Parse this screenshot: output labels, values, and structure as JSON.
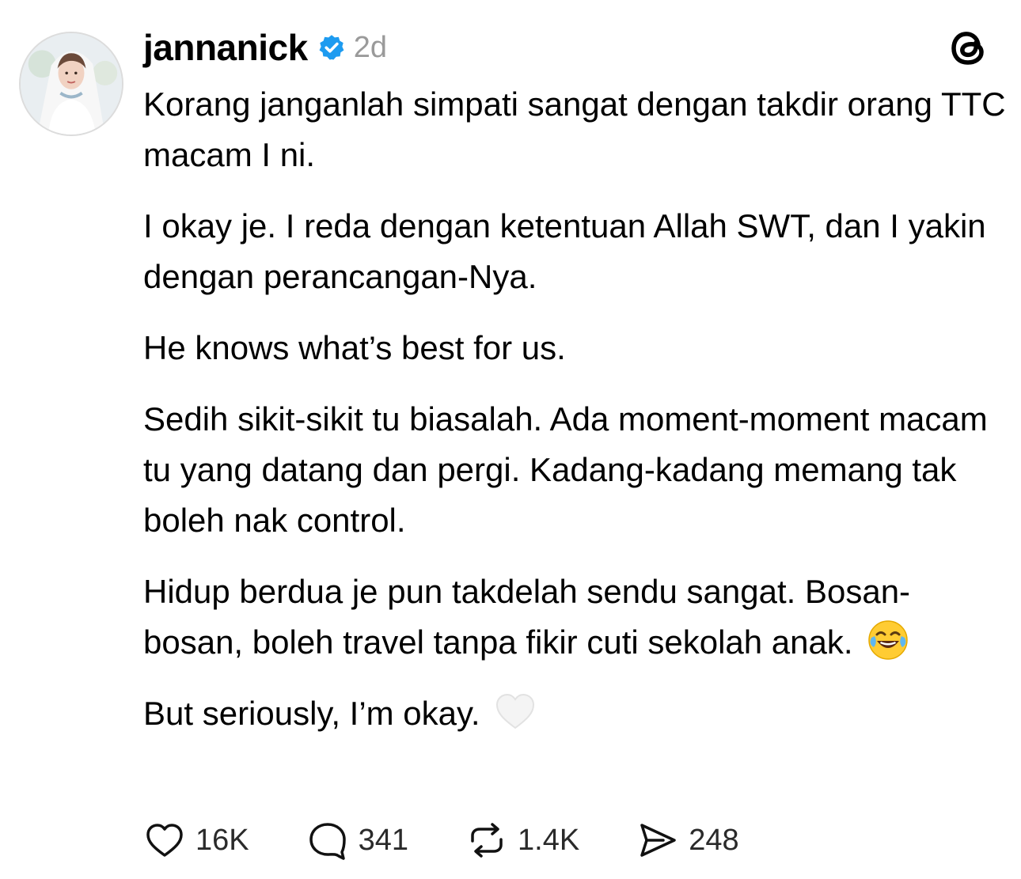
{
  "post": {
    "username": "jannanick",
    "timestamp": "2d",
    "paragraphs": [
      "Korang janganlah simpati sangat dengan takdir orang TTC macam I ni.",
      "I okay je. I reda dengan ketentuan Allah SWT, dan I yakin dengan perancangan-Nya.",
      "He knows what’s best for us.",
      "Sedih sikit-sikit tu biasalah. Ada moment-moment macam tu yang datang dan pergi. Kadang-kadang memang tak boleh nak control.",
      "Hidup berdua je pun takdelah sendu sangat. Bosan-bosan, boleh travel tanpa fikir cuti sekolah anak.",
      "But seriously, I’m okay."
    ],
    "emojis": {
      "laughing": "face-with-tears-of-joy",
      "heart": "white-heart"
    }
  },
  "actions": {
    "likes": "16K",
    "replies": "341",
    "reposts": "1.4K",
    "shares": "248"
  },
  "icons": {
    "like": "heart-icon",
    "reply": "comment-bubble-icon",
    "repost": "repost-icon",
    "share": "send-icon",
    "verified": "verified-badge-icon",
    "logo": "threads-logo-icon"
  },
  "colors": {
    "verified": "#1d9bf0",
    "timestamp": "#9a9a9a",
    "text": "#000000"
  }
}
